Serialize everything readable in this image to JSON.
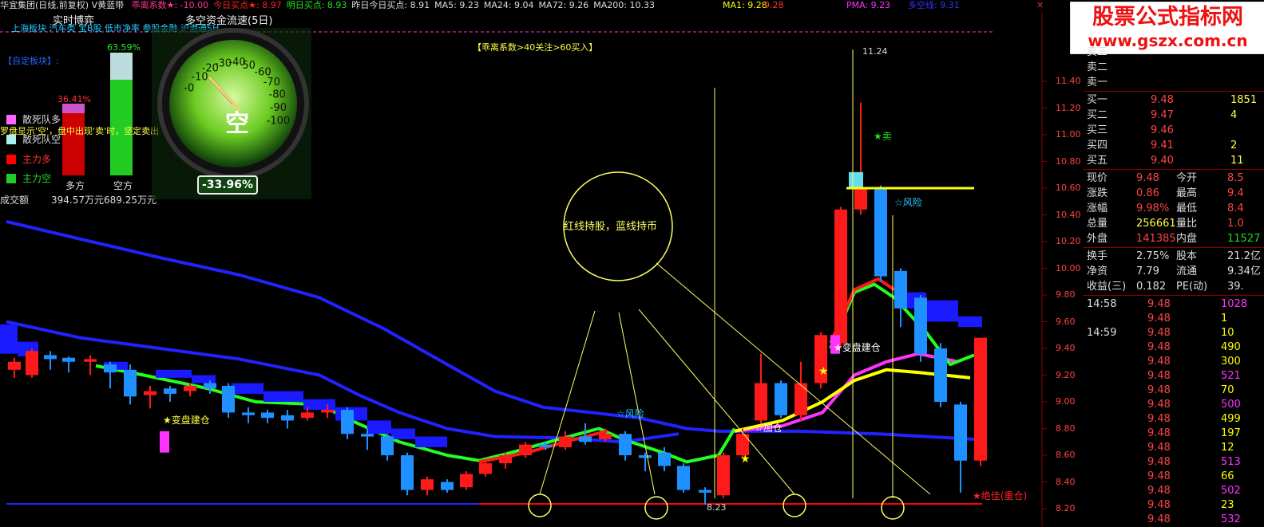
{
  "header": {
    "title": "华宜集团(日线,前复权) V黄蓝带",
    "indicators": [
      {
        "text": "乖离系数★: -10.00",
        "color": "#ff3399"
      },
      {
        "text": "今日买点★: 8.97",
        "color": "#ff2222"
      },
      {
        "text": "明日买点: 8.93",
        "color": "#22dd22"
      },
      {
        "text": "昨日今日买点: 8.91",
        "color": "#dddddd"
      },
      {
        "text": "MA5: 9.23",
        "color": "#dddddd"
      },
      {
        "text": "MA24: 9.04",
        "color": "#dddddd"
      },
      {
        "text": "MA72: 9.26",
        "color": "#dddddd"
      },
      {
        "text": "MA200: 10.33",
        "color": "#dddddd"
      }
    ],
    "right_indicators": [
      {
        "text": "MA1: 9.28",
        "color": "#ffff00"
      },
      {
        "text": "9.28",
        "color": "#ff3333"
      },
      {
        "text": "PMA: 9.23",
        "color": "#ff33ff"
      },
      {
        "text": "多空线: 9.31",
        "color": "#3333ff"
      }
    ],
    "panel_tab_1": "实时博弈",
    "panel_tab_2": "多空资金流速(5日)",
    "sector_line": "上海板块 汽车类 宝B股 低市净率 参股金融 沪港通SH",
    "custom_sector": "【自定板块】:",
    "signal_note": "【乖离系数>40关注>60买入】"
  },
  "legend": {
    "items": [
      {
        "label": "散死队多",
        "color": "#ff66ff"
      },
      {
        "label": "散死队空",
        "color": "#aaeeee"
      },
      {
        "label": "主力多",
        "color": "#ff0000"
      },
      {
        "label": "主力空",
        "color": "#22cc22"
      }
    ],
    "turnover_label": "成交额",
    "note": "罗盘显示'空'，盘中出现'卖'时，坚定卖出"
  },
  "bars": {
    "buy_pct": "36.41%",
    "sell_pct": "63.59%",
    "buy_label": "多方",
    "sell_label": "空方",
    "buy_amount": "394.57万元",
    "sell_amount": "689.25万元",
    "buy_value": 36.41,
    "sell_value": 63.59
  },
  "gauge": {
    "center_text": "空",
    "value_text": "-33.96%",
    "value": -33.96,
    "ticks": [
      "-0",
      "-10",
      "-20",
      "-30",
      "-40",
      "50",
      "-60",
      "-70",
      "-80",
      "-90",
      "-100"
    ]
  },
  "chart": {
    "price_axis": [
      "11.40",
      "11.20",
      "11.00",
      "10.80",
      "10.60",
      "10.40",
      "10.20",
      "10.00",
      "9.80",
      "9.60",
      "9.40",
      "9.20",
      "9.00",
      "8.80",
      "8.60",
      "8.40",
      "8.20"
    ],
    "high_label": "11.24",
    "low_label": "8.23",
    "annotation_circle": "红线持股，蓝线持币",
    "signals": [
      "★变盘建仓",
      "☆风险",
      "☆加仓",
      "★变盘建仓",
      "★卖",
      "☆风险",
      "★绝佳(重仓)"
    ],
    "colors": {
      "up": "#ff1a1a",
      "down": "#1e90ff",
      "yellow": "#ffff00",
      "blue_line": "#2222ff",
      "green_line": "#22ff22",
      "magenta_line": "#ff33ff"
    }
  },
  "quote": {
    "sell_levels": [
      {
        "label": "卖三",
        "price": "",
        "vol": ""
      },
      {
        "label": "卖二",
        "price": "",
        "vol": ""
      },
      {
        "label": "卖一",
        "price": "",
        "vol": ""
      }
    ],
    "buy_levels": [
      {
        "label": "买一",
        "price": "9.48",
        "vol": "1851"
      },
      {
        "label": "买二",
        "price": "9.47",
        "vol": "4"
      },
      {
        "label": "买三",
        "price": "9.46",
        "vol": ""
      },
      {
        "label": "买四",
        "price": "9.41",
        "vol": "2"
      },
      {
        "label": "买五",
        "price": "9.40",
        "vol": "11"
      }
    ],
    "stats": [
      {
        "l1": "现价",
        "v1": "9.48",
        "l2": "今开",
        "v2": "8.5"
      },
      {
        "l1": "涨跌",
        "v1": "0.86",
        "l2": "最高",
        "v2": "9.4"
      },
      {
        "l1": "涨幅",
        "v1": "9.98%",
        "l2": "最低",
        "v2": "8.4"
      },
      {
        "l1": "总量",
        "v1": "256661",
        "l2": "量比",
        "v2": "1.0"
      },
      {
        "l1": "外盘",
        "v1": "141385",
        "l2": "内盘",
        "v2": "11527"
      }
    ],
    "stats2": [
      {
        "l1": "换手",
        "v1": "2.75%",
        "l2": "股本",
        "v2": "21.2亿"
      },
      {
        "l1": "净资",
        "v1": "7.79",
        "l2": "流通",
        "v2": "9.34亿"
      },
      {
        "l1": "收益(三)",
        "v1": "0.182",
        "l2": "PE(动)",
        "v2": "39."
      }
    ],
    "ticks": [
      {
        "time": "14:58",
        "price": "9.48",
        "vol": "1028",
        "vc": "#ff33ff"
      },
      {
        "time": "",
        "price": "9.48",
        "vol": "1",
        "vc": "#ffff00"
      },
      {
        "time": "14:59",
        "price": "9.48",
        "vol": "10",
        "vc": "#ffff00"
      },
      {
        "time": "",
        "price": "9.48",
        "vol": "490",
        "vc": "#ffff00"
      },
      {
        "time": "",
        "price": "9.48",
        "vol": "300",
        "vc": "#ffff00"
      },
      {
        "time": "",
        "price": "9.48",
        "vol": "521",
        "vc": "#ff33ff"
      },
      {
        "time": "",
        "price": "9.48",
        "vol": "70",
        "vc": "#ffff00"
      },
      {
        "time": "",
        "price": "9.48",
        "vol": "500",
        "vc": "#ff33ff"
      },
      {
        "time": "",
        "price": "9.48",
        "vol": "499",
        "vc": "#ffff00"
      },
      {
        "time": "",
        "price": "9.48",
        "vol": "197",
        "vc": "#ffff00"
      },
      {
        "time": "",
        "price": "9.48",
        "vol": "12",
        "vc": "#ffff00"
      },
      {
        "time": "",
        "price": "9.48",
        "vol": "513",
        "vc": "#ff33ff"
      },
      {
        "time": "",
        "price": "9.48",
        "vol": "66",
        "vc": "#ffff00"
      },
      {
        "time": "",
        "price": "9.48",
        "vol": "502",
        "vc": "#ff33ff"
      },
      {
        "time": "",
        "price": "9.48",
        "vol": "23",
        "vc": "#ffff00"
      },
      {
        "time": "",
        "price": "9.48",
        "vol": "532",
        "vc": "#ff33ff"
      }
    ]
  },
  "watermark": {
    "title": "股票公式指标网",
    "url": "www.gszx.com.cn"
  }
}
